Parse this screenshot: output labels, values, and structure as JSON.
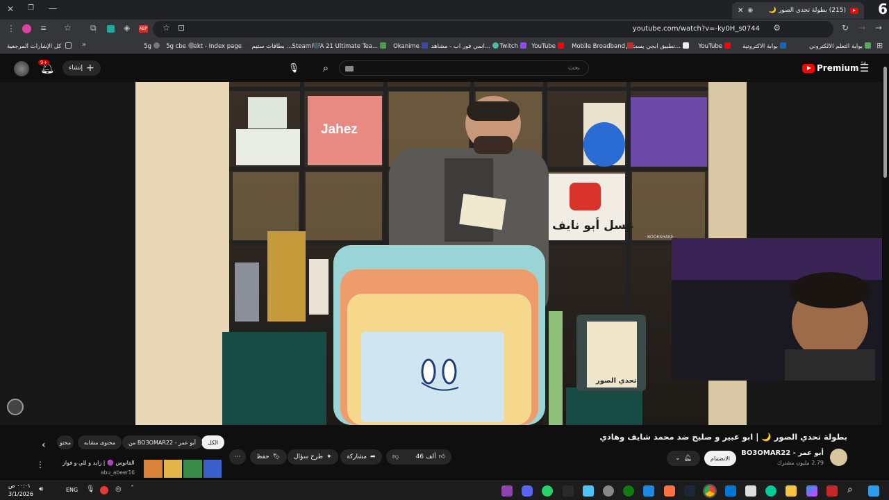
{
  "browser": {
    "tab_count_badge": "6",
    "tab_title": "(215) بطولة تحدي الصور 🌙",
    "url": "youtube.com/watch?v=-ky0H_s0744",
    "bookmarks": [
      "بوابة التعلم الالكتروني",
      "بوابة الاكترونية",
      "YouTube",
      "تطبيق ابجي يست م...",
      "Mobile Broadband",
      "YouTube",
      "Twitch",
      "انمي فور اب - مشاهد...",
      "Okanime",
      "FIFA 21 Ultimate Tea...",
      "بطاقات ستيم ...Steam",
      "rekt - Index page",
      "5g cbe",
      "5g"
    ],
    "all_bookmarks": "كل الإشارات المرجعية"
  },
  "youtube": {
    "logo_text": "Premium",
    "logo_region": "SA",
    "search_placeholder": "بحث",
    "create_label": "إنشاء",
    "notifications_badge": "9+",
    "video_title": "بطولة تحدي الصور 🌙 | ابو عبير و صليح ضد محمد شايف وهادي",
    "channel_name": "BO3OMAR22 - أبو عمر",
    "subscribers": "2.79 مليون مشترك",
    "subscribe_label": "الانضمام",
    "likes": "46 ألف",
    "share_label": "مشاركة",
    "ask_label": "طرح سؤال",
    "save_label": "حفظ",
    "more_label": "⋯",
    "chips": [
      "الكل",
      "من BO3OMAR22 - أبو عمر",
      "محتوى مشابه",
      "محتو"
    ],
    "collab_title": "الفانوس 🟣 | زايد و للي و فواز",
    "collab_handle": "abu_abeer16"
  },
  "video_scene": {
    "sign_jahez": "Jahez",
    "sign_honey": "عسل أبو نايف",
    "box_label": "تحدي الصور",
    "book_label": "BOOKSHAKE"
  },
  "taskbar": {
    "time": "٠٠:٠١ ص",
    "date": "3/1/2026",
    "lang": "ENG"
  },
  "colors": {
    "accent_red": "#ff0000",
    "bg_dark": "#0f0f0f"
  }
}
